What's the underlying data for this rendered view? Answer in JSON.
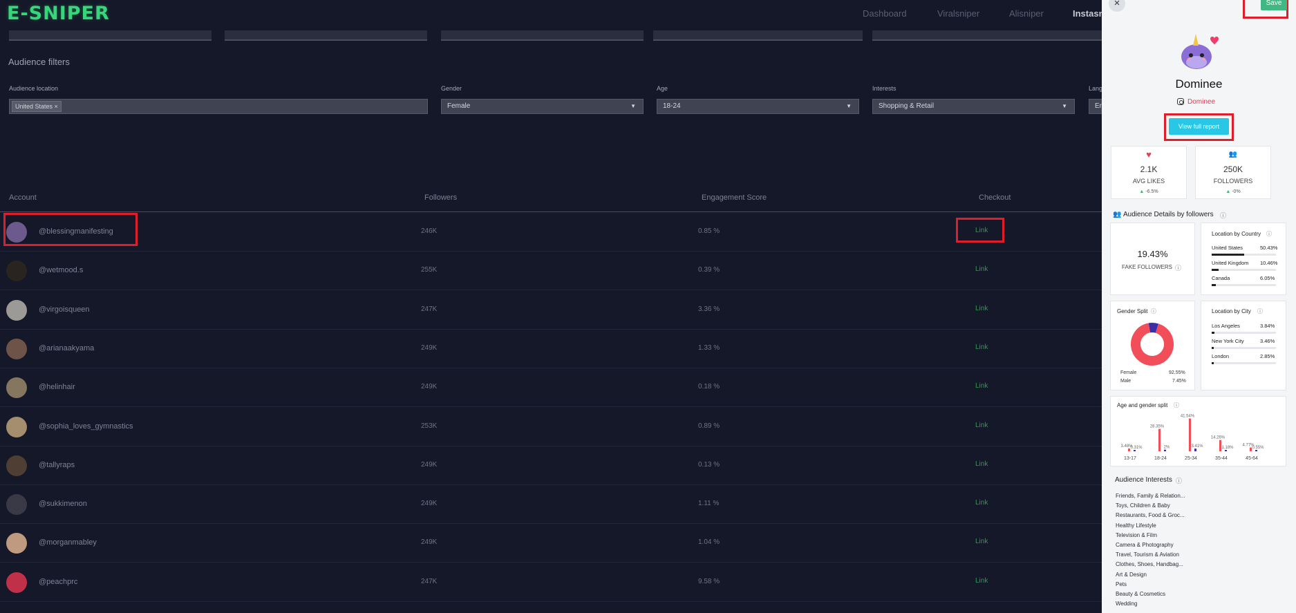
{
  "app": {
    "logo": "E-SNIPER"
  },
  "nav": {
    "items": [
      "Dashboard",
      "Viralsniper",
      "Alisniper",
      "Instasn"
    ]
  },
  "filters": {
    "section_title": "Audience filters",
    "location_label": "Audience location",
    "location_chip": "United States",
    "chip_remove": "×",
    "gender_label": "Gender",
    "gender_value": "Female",
    "age_label": "Age",
    "age_value": "18-24",
    "interests_label": "Interests",
    "interests_value": "Shopping & Retail",
    "language_label": "Lang",
    "language_value": "En",
    "dropdown_arrow": "▼"
  },
  "table": {
    "headers": [
      "Account",
      "Followers",
      "Engagement Score",
      "Checkout"
    ],
    "rows": [
      {
        "handle": "@blessingmanifesting",
        "followers": "246K",
        "engagement": "0.85 %",
        "link": "Link",
        "avatar_color": "#6c5a8c"
      },
      {
        "handle": "@wetmood.s",
        "followers": "255K",
        "engagement": "0.39 %",
        "link": "Link",
        "avatar_color": "#2a2420"
      },
      {
        "handle": "@virgoisqueen",
        "followers": "247K",
        "engagement": "3.36 %",
        "link": "Link",
        "avatar_color": "#9c9a96"
      },
      {
        "handle": "@arianaakyama",
        "followers": "249K",
        "engagement": "1.33 %",
        "link": "Link",
        "avatar_color": "#6e5448"
      },
      {
        "handle": "@helinhair",
        "followers": "249K",
        "engagement": "0.18 %",
        "link": "Link",
        "avatar_color": "#857660"
      },
      {
        "handle": "@sophia_loves_gymnastics",
        "followers": "253K",
        "engagement": "0.89 %",
        "link": "Link",
        "avatar_color": "#a58e6e"
      },
      {
        "handle": "@tallyraps",
        "followers": "249K",
        "engagement": "0.13 %",
        "link": "Link",
        "avatar_color": "#4e3e34"
      },
      {
        "handle": "@sukkimenon",
        "followers": "249K",
        "engagement": "1.11 %",
        "link": "Link",
        "avatar_color": "#3a3a46"
      },
      {
        "handle": "@morganmabley",
        "followers": "249K",
        "engagement": "1.04 %",
        "link": "Link",
        "avatar_color": "#c09a80"
      },
      {
        "handle": "@peachprc",
        "followers": "247K",
        "engagement": "9.58 %",
        "link": "Link",
        "avatar_color": "#c03048"
      }
    ]
  },
  "panel": {
    "close": "×",
    "save": "Save",
    "name": "Dominee",
    "username": "Dominee",
    "view_full_report": "View full report",
    "avg_likes": {
      "value": "2.1K",
      "label": "AVG LIKES",
      "change": "-6.5%"
    },
    "followers": {
      "value": "250K",
      "label": "FOLLOWERS",
      "change": "-0%"
    },
    "audience_title": "Audience Details by followers",
    "fake_followers": {
      "value": "19.43%",
      "label": "FAKE FOLLOWERS"
    },
    "location_country": {
      "title": "Location by Country",
      "items": [
        {
          "name": "United States",
          "pct": "50.43%",
          "fraction": 0.5043
        },
        {
          "name": "United Kingdom",
          "pct": "10.46%",
          "fraction": 0.1046
        },
        {
          "name": "Canada",
          "pct": "6.05%",
          "fraction": 0.0605
        }
      ]
    },
    "gender_split": {
      "title": "Gender Split",
      "female_label": "Female",
      "female_pct": "92.55%",
      "female_value": 92.55,
      "male_label": "Male",
      "male_pct": "7.45%",
      "male_value": 7.45,
      "female_color": "#f24e5a",
      "male_color": "#3b2fa6"
    },
    "location_city": {
      "title": "Location by City",
      "items": [
        {
          "name": "Los Angeles",
          "pct": "3.84%",
          "fraction": 0.0384
        },
        {
          "name": "New York City",
          "pct": "3.46%",
          "fraction": 0.0346
        },
        {
          "name": "London",
          "pct": "2.85%",
          "fraction": 0.0285
        }
      ]
    },
    "age_gender_title": "Age and gender split",
    "interests_title": "Audience Interests",
    "interests": [
      "Friends, Family & Relation...",
      "Toys, Children & Baby",
      "Restaurants, Food & Groc...",
      "Healthy Lifestyle",
      "Television & Film",
      "Camera & Photography",
      "Travel, Tourism & Aviation",
      "Clothes, Shoes, Handbag...",
      "Art & Design",
      "Pets",
      "Beauty & Cosmetics",
      "Wedding"
    ]
  },
  "chart_data": {
    "type": "bar",
    "title": "Age and gender split",
    "categories": [
      "13-17",
      "18-24",
      "25-34",
      "35-44",
      "45-64"
    ],
    "series": [
      {
        "values": [
          3.48,
          28.35,
          41.54,
          14.26,
          4.77
        ],
        "labels": [
          "3.48%",
          "28.35%",
          "41.54%",
          "14.26%",
          "4.77%"
        ],
        "color": "#f24e5a"
      },
      {
        "values": [
          0.31,
          2,
          3.41,
          1.18,
          0.55
        ],
        "labels": [
          "0.31%",
          "2%",
          "3.41%",
          "1.18%",
          "0.55%"
        ],
        "color": "#3b2fa6"
      }
    ],
    "ylim": [
      0,
      42
    ],
    "grid": false
  }
}
